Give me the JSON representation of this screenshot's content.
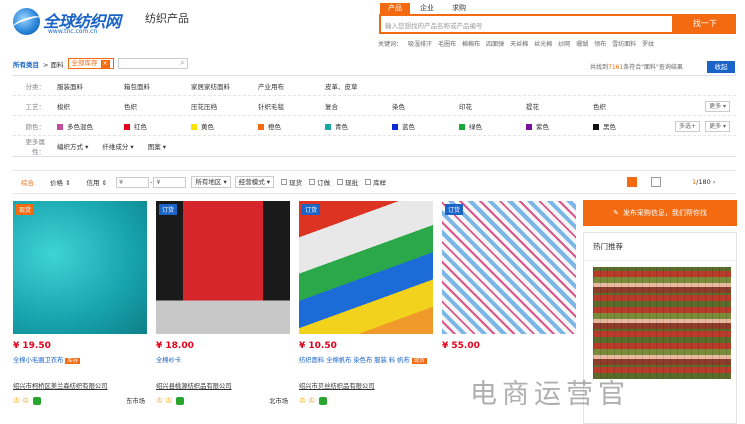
{
  "header": {
    "logo_text": "全球纺织网",
    "logo_url": "www.tnc.com.cn",
    "channel": "纺织产品",
    "search_tabs": [
      "产品",
      "企业",
      "求购"
    ],
    "search_placeholder": "输入您想找的产品名称或产品编号",
    "search_button": "找一下",
    "keywords_label": "关键词：",
    "keywords": [
      "吸湿排汗",
      "毛圈布",
      "棉棉布",
      "四面弹",
      "天丝棉",
      "丝光棉",
      "纱网",
      "珊瑚",
      "领布",
      "雪纺面料",
      "罗纹"
    ]
  },
  "breadcrumb": {
    "root": "所有类目",
    "sep": "> 面料",
    "tag": "全部库存",
    "tag_close": "×"
  },
  "results": {
    "prefix": "共找到",
    "count": "7161",
    "suffix": "条符合\"面料\"查询结果",
    "collapse": "收起"
  },
  "filters": {
    "category_label": "分类：",
    "categories": [
      "服装面料",
      "箱包面料",
      "家居家纺面料",
      "产业用布",
      "皮革、皮草"
    ],
    "process_label": "工艺：",
    "processes": [
      "梭织",
      "色织",
      "压花压绉",
      "针织毛毯",
      "复合",
      "染色",
      "印花",
      "提花",
      "色织"
    ],
    "color_label": "颜色：",
    "colors": [
      {
        "name": "多色混色",
        "color": "#c44da0"
      },
      {
        "name": "红色",
        "color": "#e4001a"
      },
      {
        "name": "黄色",
        "color": "#ffe100"
      },
      {
        "name": "橙色",
        "color": "#f36a10"
      },
      {
        "name": "青色",
        "color": "#19a6a0"
      },
      {
        "name": "蓝色",
        "color": "#0a2bd6"
      },
      {
        "name": "绿色",
        "color": "#18a83a"
      },
      {
        "name": "紫色",
        "color": "#7a0fa0"
      },
      {
        "name": "黑色",
        "color": "#111111"
      }
    ],
    "advanced_label": "更多属性：",
    "advanced": [
      "编织方式 ▾",
      "纤维成分 ▾",
      "图案 ▾"
    ],
    "more": "更多 ▾",
    "multi": "多选+"
  },
  "sortbar": {
    "items": [
      "综合",
      "价格 ⇕",
      "信用 ⇕"
    ],
    "price_from": "¥",
    "price_to": "¥",
    "region": "所有地区 ▾",
    "business": "经营模式 ▾",
    "checks": [
      "现货",
      "订做",
      "现批",
      "库样"
    ],
    "page_current": "1",
    "page_total": "/180",
    "next": "›"
  },
  "products": [
    {
      "badge": "现货",
      "badge_color": "#f36a10",
      "price": "¥ 19.50",
      "name": "全棉小毛圈卫衣布",
      "tag": "库存",
      "company": "绍兴市柯桥区美兰森纺织有限公司",
      "location": "东市场"
    },
    {
      "badge": "订货",
      "badge_color": "#1a64c8",
      "price": "¥ 18.00",
      "name": "全棉纱卡",
      "tag": "",
      "company": "绍兴县桃源纺织品有限公司",
      "location": "北市场"
    },
    {
      "badge": "订货",
      "badge_color": "#1a64c8",
      "price": "¥ 10.50",
      "name": "纺织面料 全棉帆布 染色布 服装 料 帆布",
      "tag": "现货",
      "company": "绍兴市贝丝纺织品有限公司",
      "location": ""
    },
    {
      "badge": "订货",
      "badge_color": "#1a64c8",
      "price": "¥ 55.00",
      "name": "",
      "tag": "",
      "company": "",
      "location": ""
    }
  ],
  "sidebar": {
    "publish": "发布采购信息，我们帮你找",
    "hot_title": "热门推荐"
  },
  "watermark": "电商运营官",
  "card_images": [
    "teal",
    "poplin",
    "swatches",
    "stripes"
  ]
}
